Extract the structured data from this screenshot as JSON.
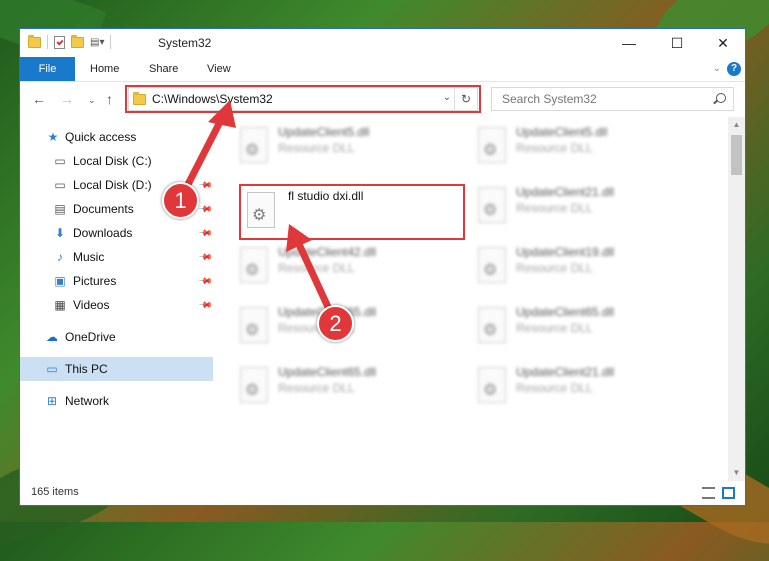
{
  "window": {
    "title": "System32",
    "controls": {
      "minimize": "—",
      "maximize": "☐",
      "close": "✕"
    }
  },
  "ribbon": {
    "tabs": [
      "File",
      "Home",
      "Share",
      "View"
    ],
    "help": "?"
  },
  "navigation": {
    "address": "C:\\Windows\\System32",
    "search_placeholder": "Search System32"
  },
  "sidebar": {
    "items": [
      {
        "label": "Quick access",
        "icon": "star-icon"
      },
      {
        "label": "Local Disk (C:)",
        "icon": "drive-icon"
      },
      {
        "label": "Local Disk (D:)",
        "icon": "drive-icon"
      },
      {
        "label": "Documents",
        "icon": "documents-icon"
      },
      {
        "label": "Downloads",
        "icon": "download-icon"
      },
      {
        "label": "Music",
        "icon": "music-icon"
      },
      {
        "label": "Pictures",
        "icon": "pictures-icon"
      },
      {
        "label": "Videos",
        "icon": "videos-icon"
      },
      {
        "label": "OneDrive",
        "icon": "onedrive-icon"
      },
      {
        "label": "This PC",
        "icon": "pc-icon"
      },
      {
        "label": "Network",
        "icon": "network-icon"
      }
    ]
  },
  "files": {
    "left": [
      {
        "name": "UpdateClient5.dll",
        "type": "Resource DLL"
      },
      {
        "name": "fl studio dxi.dll",
        "type": ""
      },
      {
        "name": "UpdateClient42.dll",
        "type": "Resource DLL"
      },
      {
        "name": "UpdateClient65.dll",
        "type": "Resource DLL"
      },
      {
        "name": "UpdateClient65.dll",
        "type": "Resource DLL"
      }
    ],
    "right": [
      {
        "name": "UpdateClient5.dll",
        "type": "Resource DLL"
      },
      {
        "name": "UpdateClient21.dll",
        "type": "Resource DLL"
      },
      {
        "name": "UpdateClient19.dll",
        "type": "Resource DLL"
      },
      {
        "name": "UpdateClient65.dll",
        "type": "Resource DLL"
      },
      {
        "name": "UpdateClient21.dll",
        "type": "Resource DLL"
      }
    ]
  },
  "status": {
    "item_count": "165 items"
  },
  "annotations": {
    "step1": "1",
    "step2": "2",
    "color": "#e0373a"
  }
}
